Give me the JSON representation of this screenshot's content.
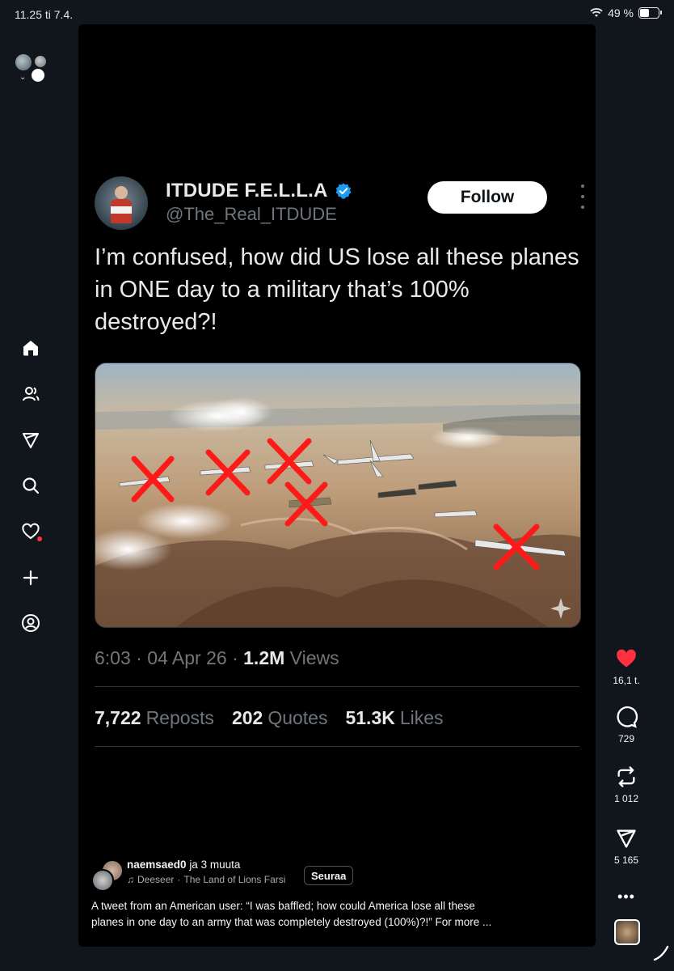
{
  "status_bar": {
    "time": "11.25  ti 7.4.",
    "battery": "49 %"
  },
  "left_nav": {
    "items": [
      "home-icon",
      "people-icon",
      "send-icon",
      "search-icon",
      "heart-icon",
      "plus-icon",
      "profile-icon"
    ]
  },
  "tweet": {
    "display_name": "ITDUDE F.E.L.L.A",
    "handle": "@The_Real_ITDUDE",
    "follow_label": "Follow",
    "text": "I’m confused, how did US lose all these planes in ONE day to a military that’s 100% destroyed?!",
    "time": "6:03",
    "date": "04 Apr 26",
    "views_count": "1.2M",
    "views_label": "Views",
    "reposts_count": "7,722",
    "reposts_label": "Reposts",
    "quotes_count": "202",
    "quotes_label": "Quotes",
    "likes_count": "51.3K",
    "likes_label": "Likes"
  },
  "post": {
    "author": "naemsaed0",
    "coauthors": "ja 3 muuta",
    "music_artist": "Deeseer",
    "music_separator": "·",
    "music_track": "The Land of Lions Farsi",
    "follow_label": "Seuraa",
    "caption_line1": "A tweet from an American user: “I was baffled; how could America lose all these",
    "caption_line2": "planes in one day to an army that was completely destroyed (100%)?!” For more ..."
  },
  "actions": {
    "likes": "16,1 t.",
    "comments": "729",
    "reposts": "1 012",
    "shares": "5 165"
  },
  "colors": {
    "like_red": "#ff3040",
    "verified_blue": "#1d9bf0",
    "muted_text": "#71767b",
    "x_mark_red": "#ff1a1a"
  }
}
